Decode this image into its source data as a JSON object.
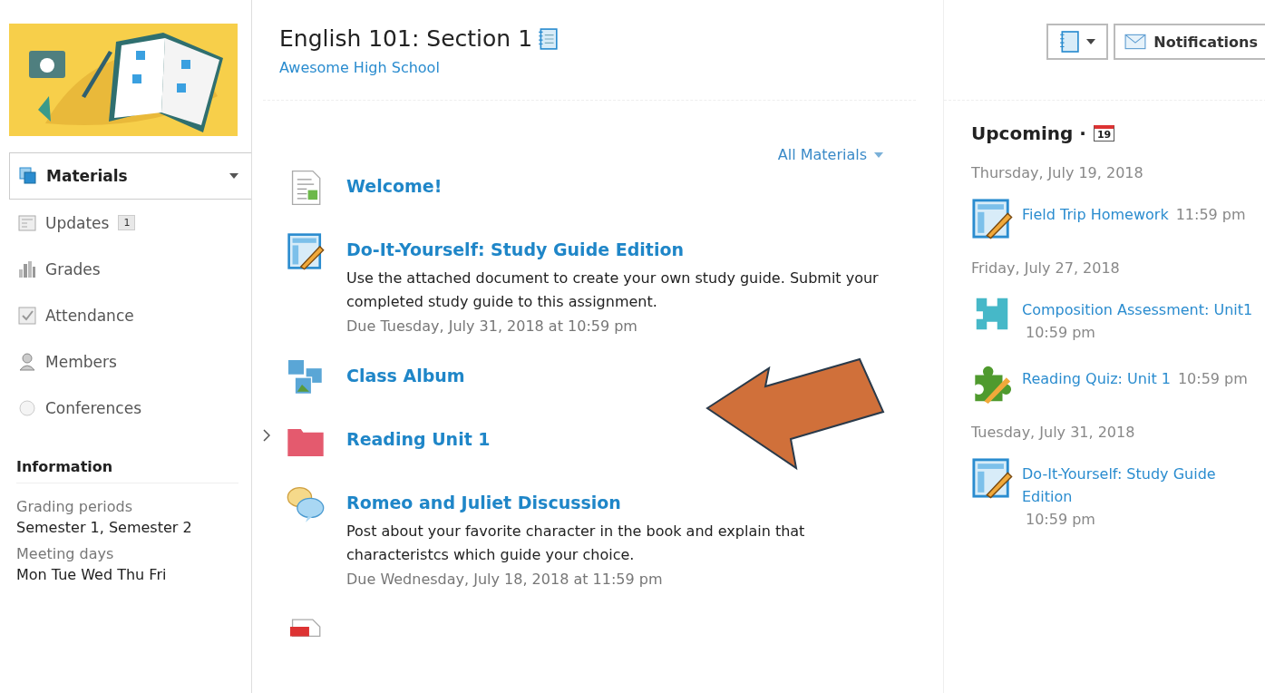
{
  "course": {
    "title": "English 101: Section 1",
    "school": "Awesome High School"
  },
  "toolbar": {
    "notifications": "Notifications"
  },
  "sidebar": {
    "items": [
      {
        "kind": "materials",
        "label": "Materials",
        "selected": true
      },
      {
        "kind": "updates",
        "label": "Updates",
        "selected": false,
        "badge": "1"
      },
      {
        "kind": "grades",
        "label": "Grades",
        "selected": false
      },
      {
        "kind": "attendance",
        "label": "Attendance",
        "selected": false
      },
      {
        "kind": "members",
        "label": "Members",
        "selected": false
      },
      {
        "kind": "conferences",
        "label": "Conferences",
        "selected": false
      }
    ],
    "information": {
      "title": "Information",
      "fields": [
        {
          "label": "Grading periods",
          "value": "Semester 1, Semester 2"
        },
        {
          "label": "Meeting days",
          "value": "Mon Tue Wed Thu Fri"
        }
      ]
    }
  },
  "materials": {
    "filter": "All Materials",
    "items": [
      {
        "kind": "document",
        "title": "Welcome!"
      },
      {
        "kind": "assignment",
        "title": "Do-It-Yourself: Study Guide Edition",
        "description": "Use the attached document to create your own study guide. Submit your completed study guide to this assignment.",
        "due": "Due Tuesday, July 31, 2018 at 10:59 pm"
      },
      {
        "kind": "album",
        "title": "Class Album"
      },
      {
        "kind": "folder",
        "title": "Reading Unit 1",
        "expanded": false
      },
      {
        "kind": "discussion",
        "title": "Romeo and Juliet Discussion",
        "description": "Post about your favorite character in the book and explain that characteristcs which guide your choice.",
        "due": "Due Wednesday, July 18, 2018 at 11:59 pm"
      },
      {
        "kind": "pdf"
      }
    ]
  },
  "upcoming": {
    "title": "Upcoming ·",
    "calendar_day": "19",
    "groups": [
      {
        "date": "Thursday, July 19, 2018",
        "items": [
          {
            "kind": "assignment",
            "title": "Field Trip Homework",
            "time": "11:59 pm"
          }
        ]
      },
      {
        "date": "Friday, July 27, 2018",
        "items": [
          {
            "kind": "assessment",
            "title": "Composition Assessment: Unit1",
            "time": "10:59 pm"
          },
          {
            "kind": "quiz",
            "title": "Reading Quiz: Unit 1",
            "time": "10:59 pm"
          }
        ]
      },
      {
        "date": "Tuesday, July 31, 2018",
        "items": [
          {
            "kind": "assignment",
            "title": "Do-It-Yourself: Study Guide Edition",
            "time": "10:59 pm"
          }
        ]
      }
    ]
  }
}
